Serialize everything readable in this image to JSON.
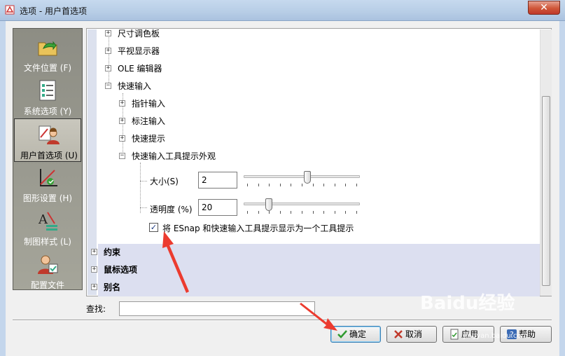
{
  "window": {
    "title": "选项 - 用户首选项",
    "close_symbol": "✕"
  },
  "nav": {
    "items": [
      {
        "label": "文件位置 (F)",
        "icon": "folder-arrow-icon",
        "active": false
      },
      {
        "label": "系统选项 (Y)",
        "icon": "checklist-icon",
        "active": false
      },
      {
        "label": "用户首选项 (U)",
        "icon": "user-preferences-icon",
        "active": true
      },
      {
        "label": "图形设置 (H)",
        "icon": "graphics-settings-icon",
        "active": false
      },
      {
        "label": "制图样式 (L)",
        "icon": "drafting-style-icon",
        "active": false
      },
      {
        "label": "配置文件",
        "icon": "profile-icon",
        "active": false
      }
    ]
  },
  "tree": {
    "items": [
      {
        "label": "尺寸调色板",
        "expander": "+"
      },
      {
        "label": "平视显示器",
        "expander": "+"
      },
      {
        "label": "OLE 编辑器",
        "expander": "+"
      },
      {
        "label": "快速输入",
        "expander": "−"
      },
      {
        "label": "指针输入",
        "expander": "+"
      },
      {
        "label": "标注输入",
        "expander": "+"
      },
      {
        "label": "快速提示",
        "expander": "+"
      },
      {
        "label": "快速输入工具提示外观",
        "expander": "−"
      }
    ],
    "size": {
      "label": "大小(S)",
      "value": "2",
      "slider_fraction": 0.55
    },
    "transparency": {
      "label": "透明度 (%)",
      "value": "20",
      "slider_fraction": 0.2
    },
    "checkbox": {
      "label": "将 ESnap 和快速输入工具提示显示为一个工具提示",
      "checked": true,
      "mark": "✓"
    },
    "groups": [
      {
        "label": "约束",
        "expander": "+"
      },
      {
        "label": "鼠标选项",
        "expander": "+"
      },
      {
        "label": "别名",
        "expander": "+"
      }
    ]
  },
  "find": {
    "label": "查找:",
    "value": ""
  },
  "buttons": {
    "ok": "确定",
    "cancel": "取消",
    "apply": "应用",
    "help": "帮助"
  },
  "watermark": {
    "text": "Baidu经验",
    "url_text": "jingyan.baidu.com"
  },
  "colors": {
    "annotation_arrow": "#ec3b2f",
    "accent": "#3c7fb1",
    "group_band": "#dcdff0"
  }
}
